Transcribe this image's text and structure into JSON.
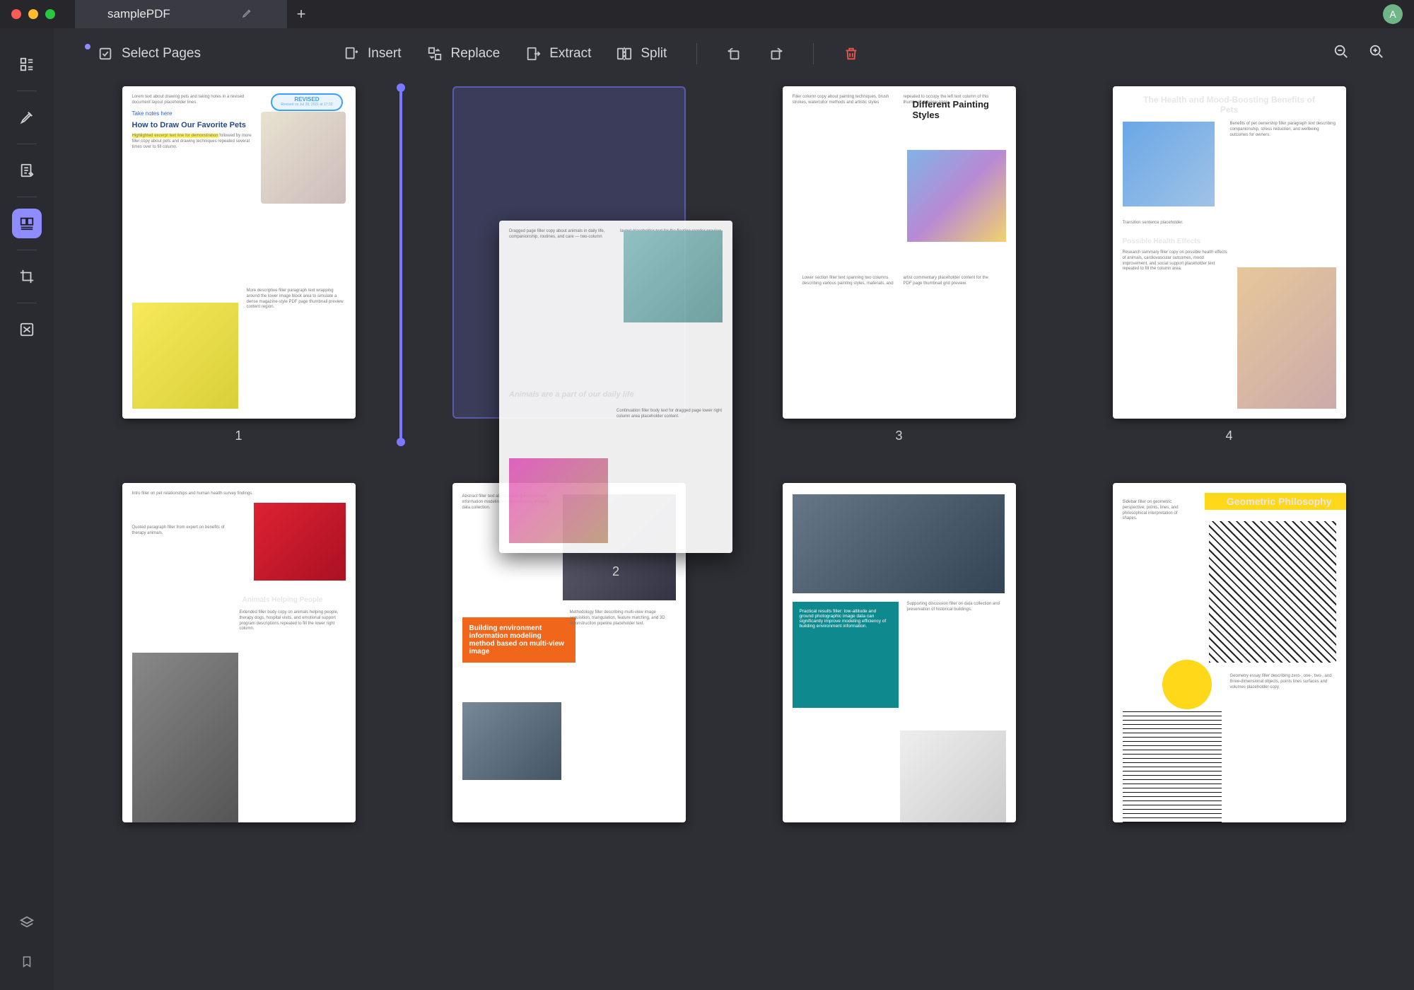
{
  "window": {
    "tab_title": "samplePDF",
    "avatar_letter": "A"
  },
  "toolbar": {
    "select_pages": "Select Pages",
    "insert": "Insert",
    "replace": "Replace",
    "extract": "Extract",
    "split": "Split"
  },
  "rail": {
    "items": [
      "thumbnails",
      "highlight",
      "edit-page",
      "page-organize",
      "crop",
      "redact"
    ]
  },
  "pages": {
    "nums": [
      "1",
      "2",
      "3",
      "4"
    ],
    "p1": {
      "revised": "REVISED",
      "title": "How to Draw Our Favorite Pets",
      "note": "Take notes here"
    },
    "drag": {
      "title": "Animals are a part of our daily life"
    },
    "p3": {
      "title": "Different Painting Styles"
    },
    "p4": {
      "title": "The Health and Mood-Boosting Benefits of Pets",
      "sub": "Possible Health Effects"
    },
    "p5": {
      "sub": "Animals Helping People"
    },
    "p6": {
      "title": "Building environment information modeling method based on multi-view image"
    },
    "p8": {
      "title": "Geometric Philosophy"
    }
  }
}
